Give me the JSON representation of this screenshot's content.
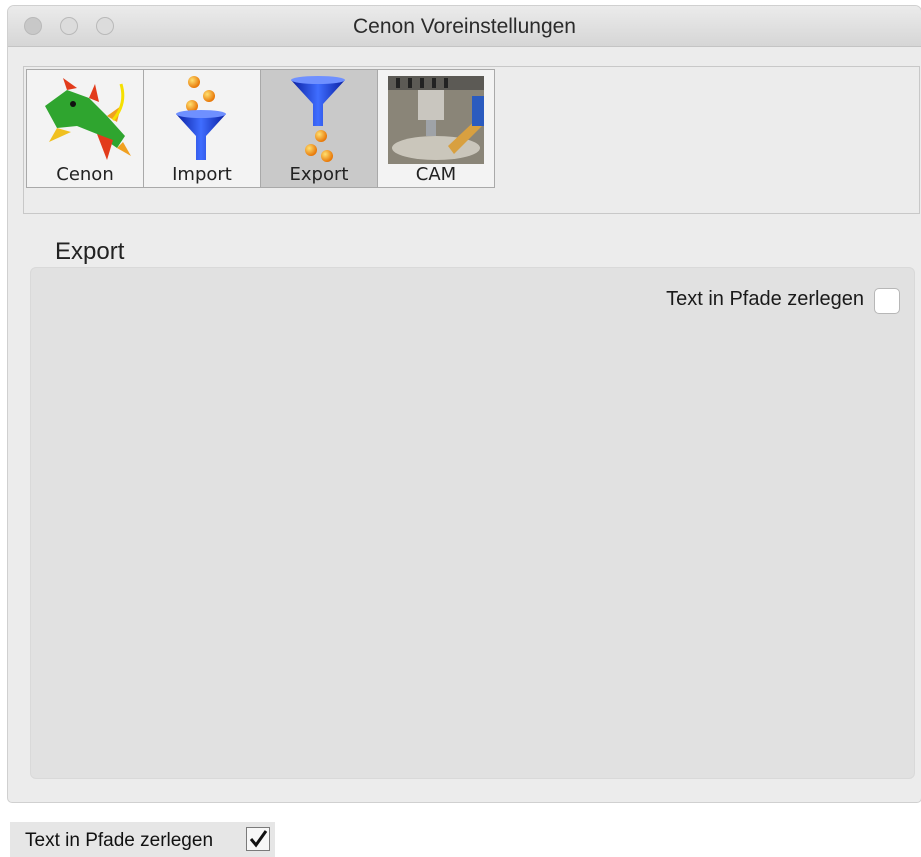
{
  "window": {
    "title": "Cenon Voreinstellungen"
  },
  "toolbar": {
    "tabs": [
      {
        "label": "Cenon",
        "icon": "dragon-icon",
        "selected": false
      },
      {
        "label": "Import",
        "icon": "import-funnel-icon",
        "selected": false
      },
      {
        "label": "Export",
        "icon": "export-funnel-icon",
        "selected": true
      },
      {
        "label": "CAM",
        "icon": "cam-machine-icon",
        "selected": false
      }
    ]
  },
  "section": {
    "title": "Export"
  },
  "options": {
    "text_to_paths_label": "Text in Pfade zerlegen",
    "text_to_paths_checked": false
  },
  "snippet": {
    "label": "Text in Pfade zerlegen",
    "checked": true
  },
  "colors": {
    "window_bg": "#ececec",
    "panel_bg": "#e1e1e1",
    "selected_tab": "#c9c9c9",
    "funnel_blue": "#1a3fd6",
    "ball_orange": "#f59a1a"
  }
}
